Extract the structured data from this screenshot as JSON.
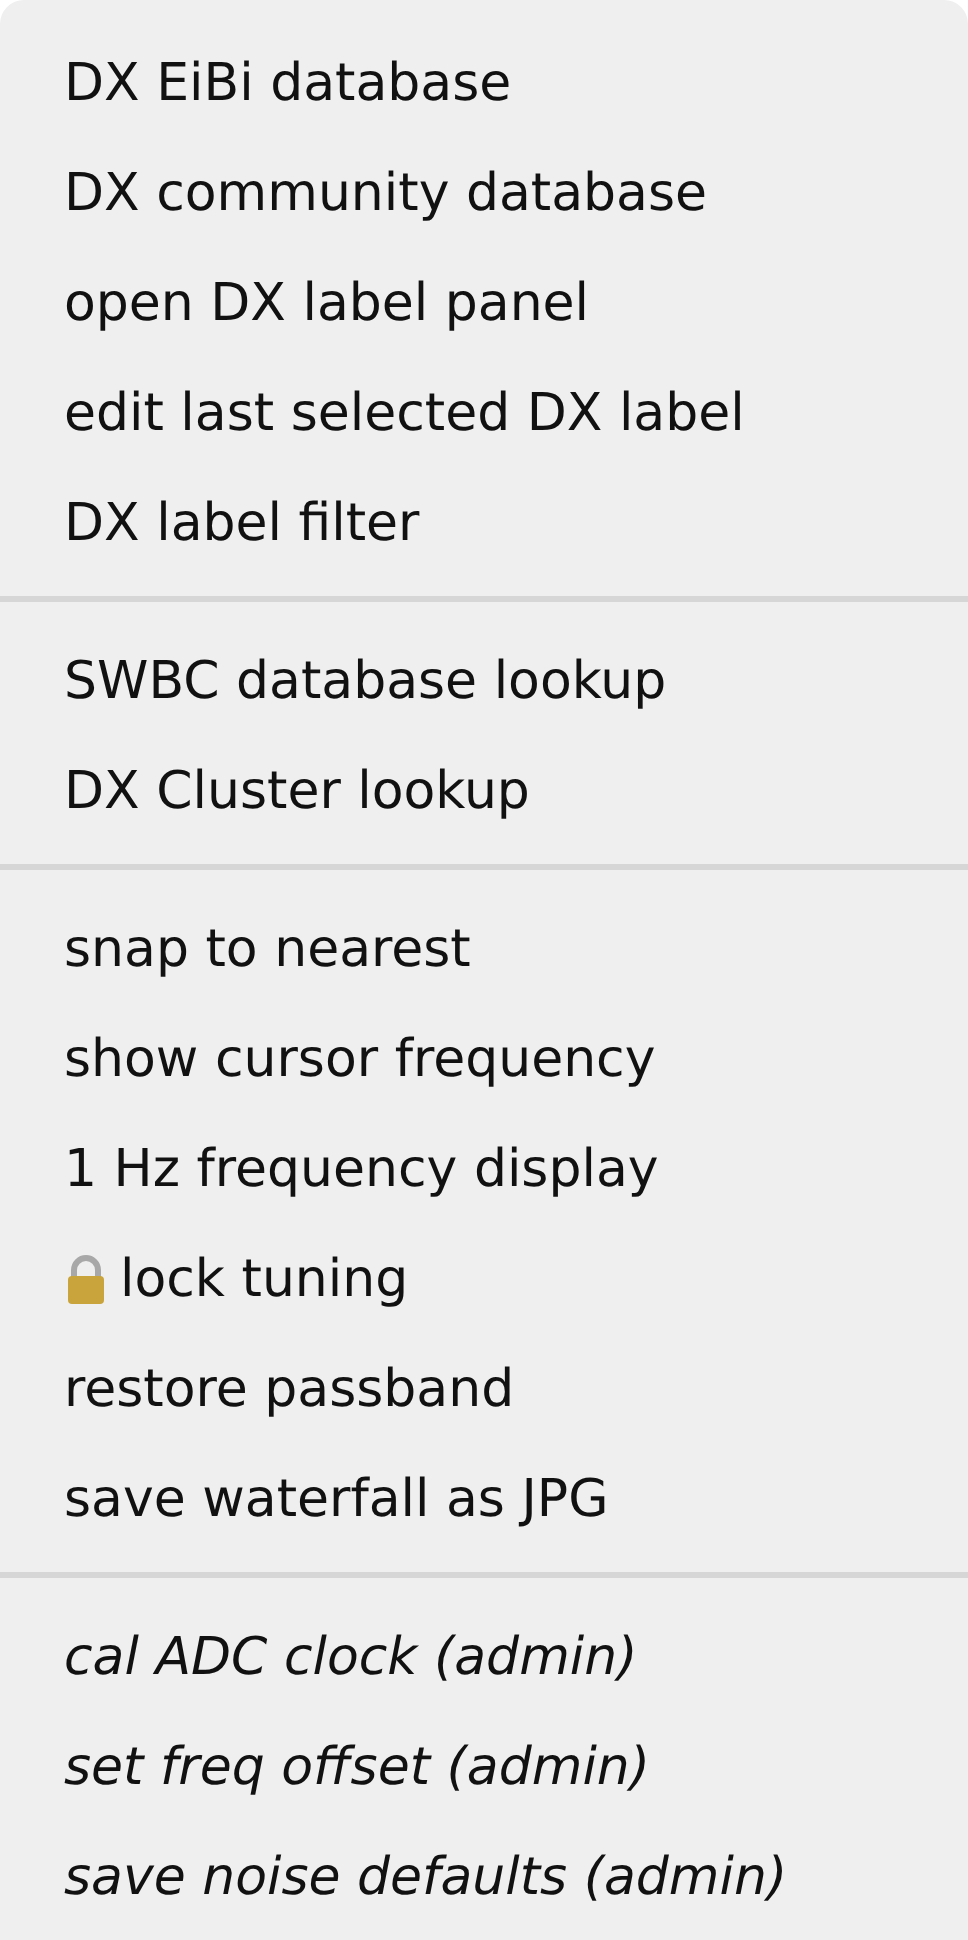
{
  "menu": {
    "groups": [
      {
        "items": [
          {
            "label": "DX EiBi database",
            "kind": "normal"
          },
          {
            "label": "DX community database",
            "kind": "normal"
          },
          {
            "label": "open DX label panel",
            "kind": "normal"
          },
          {
            "label": "edit last selected DX label",
            "kind": "normal"
          },
          {
            "label": "DX label filter",
            "kind": "normal"
          }
        ]
      },
      {
        "items": [
          {
            "label": "SWBC database lookup",
            "kind": "normal"
          },
          {
            "label": "DX Cluster lookup",
            "kind": "normal"
          }
        ]
      },
      {
        "items": [
          {
            "label": "snap to nearest",
            "kind": "normal"
          },
          {
            "label": "show cursor frequency",
            "kind": "normal"
          },
          {
            "label": "1 Hz frequency display",
            "kind": "normal"
          },
          {
            "label": "lock tuning",
            "kind": "lock"
          },
          {
            "label": "restore passband",
            "kind": "normal"
          },
          {
            "label": "save waterfall as JPG",
            "kind": "normal"
          }
        ]
      },
      {
        "items": [
          {
            "label": "cal ADC clock (admin)",
            "kind": "admin"
          },
          {
            "label": "set freq offset (admin)",
            "kind": "admin"
          },
          {
            "label": "save noise defaults (admin)",
            "kind": "admin"
          }
        ]
      }
    ]
  }
}
